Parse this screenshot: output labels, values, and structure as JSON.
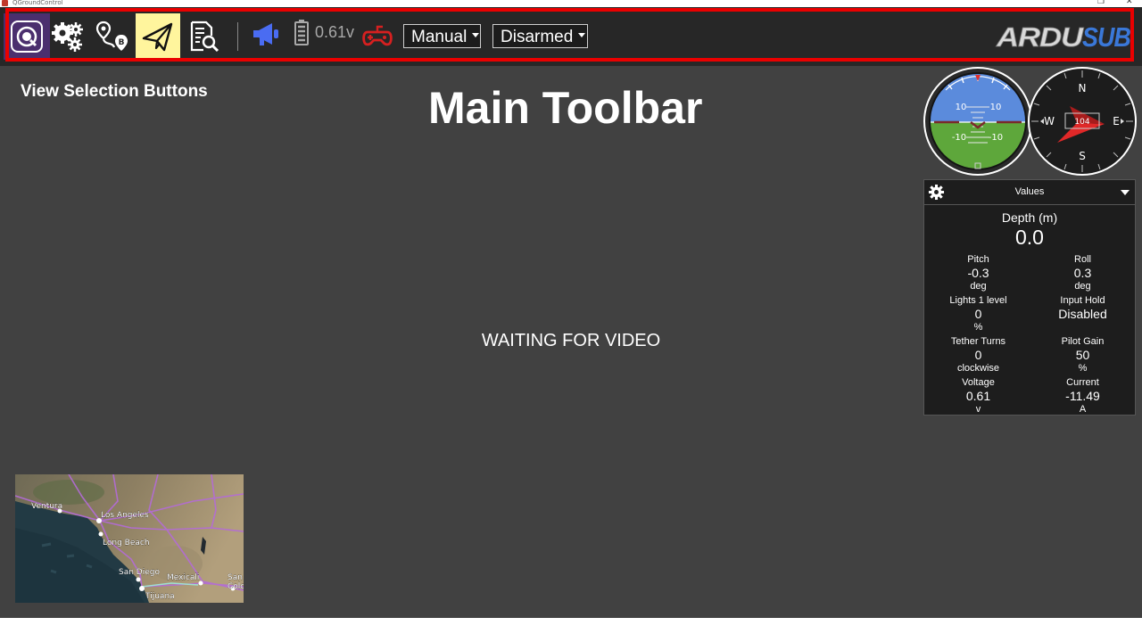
{
  "window": {
    "title": "QGroundControl"
  },
  "toolbar": {
    "view_buttons": [
      "qgc-icon",
      "vehicle-setup-icon",
      "plan-icon",
      "fly-icon",
      "analyze-icon"
    ],
    "battery_voltage": "0.61v",
    "flight_mode": "Manual",
    "arm_state": "Disarmed",
    "logo_text": "ARDUSUB",
    "colors": {
      "highlight": "#ea0000",
      "active_view": "#fff59d",
      "qgc_bg": "#4b2f6e",
      "megaphone": "#4a6cf2",
      "joystick": "#d62020",
      "logo_accent": "#3a78d8"
    }
  },
  "annotations": {
    "view_selection": "View Selection Buttons",
    "main_toolbar": "Main Toolbar"
  },
  "video": {
    "status": "WAITING FOR VIDEO"
  },
  "instruments": {
    "attitude": {
      "pitch_marks": [
        "10",
        "10",
        "-10",
        "-10"
      ]
    },
    "compass": {
      "heading": "104",
      "cardinals": [
        "N",
        "E",
        "S",
        "W"
      ]
    }
  },
  "values_widget": {
    "title": "Values",
    "depth_label": "Depth (m)",
    "depth_value": "0.0",
    "items": [
      {
        "label": "Pitch",
        "value": "-0.3",
        "unit": "deg"
      },
      {
        "label": "Roll",
        "value": "0.3",
        "unit": "deg"
      },
      {
        "label": "Lights 1 level",
        "value": "0",
        "unit": "%"
      },
      {
        "label": "Input Hold",
        "value": "Disabled",
        "unit": ""
      },
      {
        "label": "Tether Turns",
        "value": "0",
        "unit": "clockwise"
      },
      {
        "label": "Pilot Gain",
        "value": "50",
        "unit": "%"
      },
      {
        "label": "Voltage",
        "value": "0.61",
        "unit": "v"
      },
      {
        "label": "Current",
        "value": "-11.49",
        "unit": "A"
      }
    ]
  },
  "map": {
    "labels": [
      "Ventura",
      "Los Angeles",
      "Long Beach",
      "San Diego",
      "Mexicali",
      "Tijuana",
      "San",
      "Colo"
    ]
  }
}
